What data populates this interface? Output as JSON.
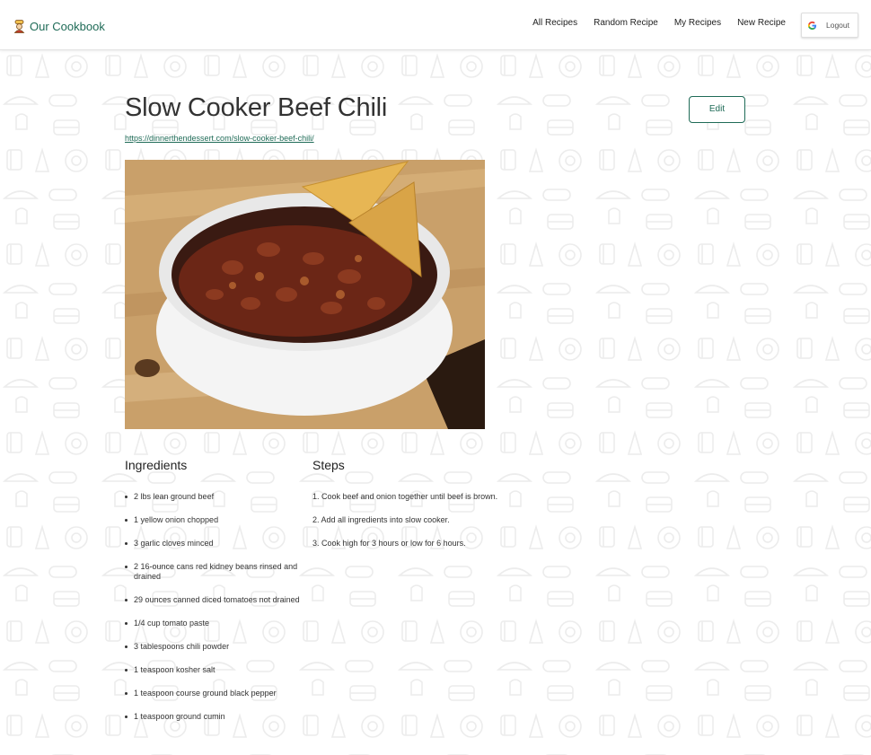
{
  "nav": {
    "brand": "Our Cookbook",
    "brand_icon": "chef-icon",
    "links": [
      "All Recipes",
      "Random Recipe",
      "My Recipes",
      "New Recipe"
    ],
    "logout_label": "Logout",
    "logout_icon": "google-icon"
  },
  "recipe": {
    "title": "Slow Cooker Beef Chili",
    "edit_label": "Edit",
    "source_url": "https://dinnerthendessert.com/slow-cooker-beef-chili/",
    "ingredients_heading": "Ingredients",
    "ingredients": [
      "2 lbs lean ground beef",
      "1 yellow onion chopped",
      "3 garlic cloves minced",
      "2 16-ounce cans red kidney beans rinsed and drained",
      "29 ounces canned diced tomatoes not drained",
      "1/4 cup tomato paste",
      "3 tablespoons chili powder",
      "1 teaspoon kosher salt",
      "1 teaspoon course ground black pepper",
      "1 teaspoon ground cumin"
    ],
    "steps_heading": "Steps",
    "steps": [
      "1. Cook beef and onion together until beef is brown.",
      "2. Add all ingredients into slow cooker.",
      "3. Cook high for 3 hours or low for 6 hours."
    ]
  },
  "colors": {
    "accent": "#1f6b57",
    "text": "#333333"
  }
}
